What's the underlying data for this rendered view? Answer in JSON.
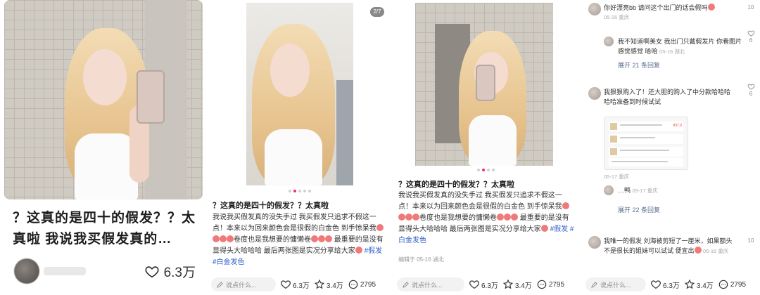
{
  "panel1": {
    "title": "？这真的是四十的假发？？太真啦 我说我买假发真的…",
    "like_count": "6.3万"
  },
  "panel2": {
    "title": "？这真的是四十的假发？？太真啦",
    "body": "我说我买假发真的没失手过 我买假发只追求不假这一点！本来以为回来颜色会是很假的白金色 到手惊呆我",
    "body2": "卷度也是我想要的慵懒卷",
    "body3": "最重要的是没有显得头大哈哈哈 最后两张图是实况分享给大家",
    "tag1": "#假发",
    "tag2": "#白金发色",
    "comment_placeholder": "说点什么...",
    "likes": "6.3万",
    "stars": "3.4万",
    "comments": "2795"
  },
  "panel3": {
    "title": "？这真的是四十的假发？？太真啦",
    "body": "我说我买假发真的没失手过 我买假发只追求不假这一点！本来以为回来颜色会是很假的白金色 到手惊呆我",
    "body2": "卷度也是我想要的慵懒卷",
    "body3": "最重要的是没有显得头大哈哈哈 最后两张图是实况分享给大家",
    "tag1": "#假发",
    "tag2": "#白金发色",
    "meta": "编辑于 05-16 湖北",
    "comment_placeholder": "说点什么...",
    "likes": "6.3万",
    "stars": "3.4万",
    "comments": "2795"
  },
  "panel4": {
    "c1_text": "你好漂亮bb 请问这个出门的话会假吗",
    "c1_time": "05-16 重庆",
    "c1_likes": "10",
    "c2_text": "我不知道啊美女 我出门只戴假发片 你看图片感觉感觉 哈哈",
    "c2_time": "05-16 湖北",
    "c2_likes": "6",
    "c2_expand": "展开 21 条回复",
    "c3_text": "我狠狠购入了！还大胆的购入了中分款哈哈哈 哈哈准备到时候试试",
    "c3_time": "05-17 重庆",
    "c3_likes": "6",
    "c4_name": "…鸭",
    "c4_time": "05-17 重庆",
    "c4_expand": "展开 22 条回复",
    "c5_text": "我唯一的假发 刘海被剪短了一厘米，如果额头不是很长的姐妹可以试试 便宜出",
    "c5_time": "05-16 重庆",
    "c5_likes": "10",
    "comment_placeholder": "说点什么...",
    "likes": "6.3万",
    "stars": "3.4万",
    "comments": "2795",
    "shot_price": "¥37.0"
  },
  "page_indicator": "2/7",
  "colors": {
    "accent": "#ff2d55",
    "tag": "#2c5ec9"
  },
  "icons": [
    "heart-icon",
    "star-icon",
    "comment-icon",
    "pencil-icon"
  ]
}
